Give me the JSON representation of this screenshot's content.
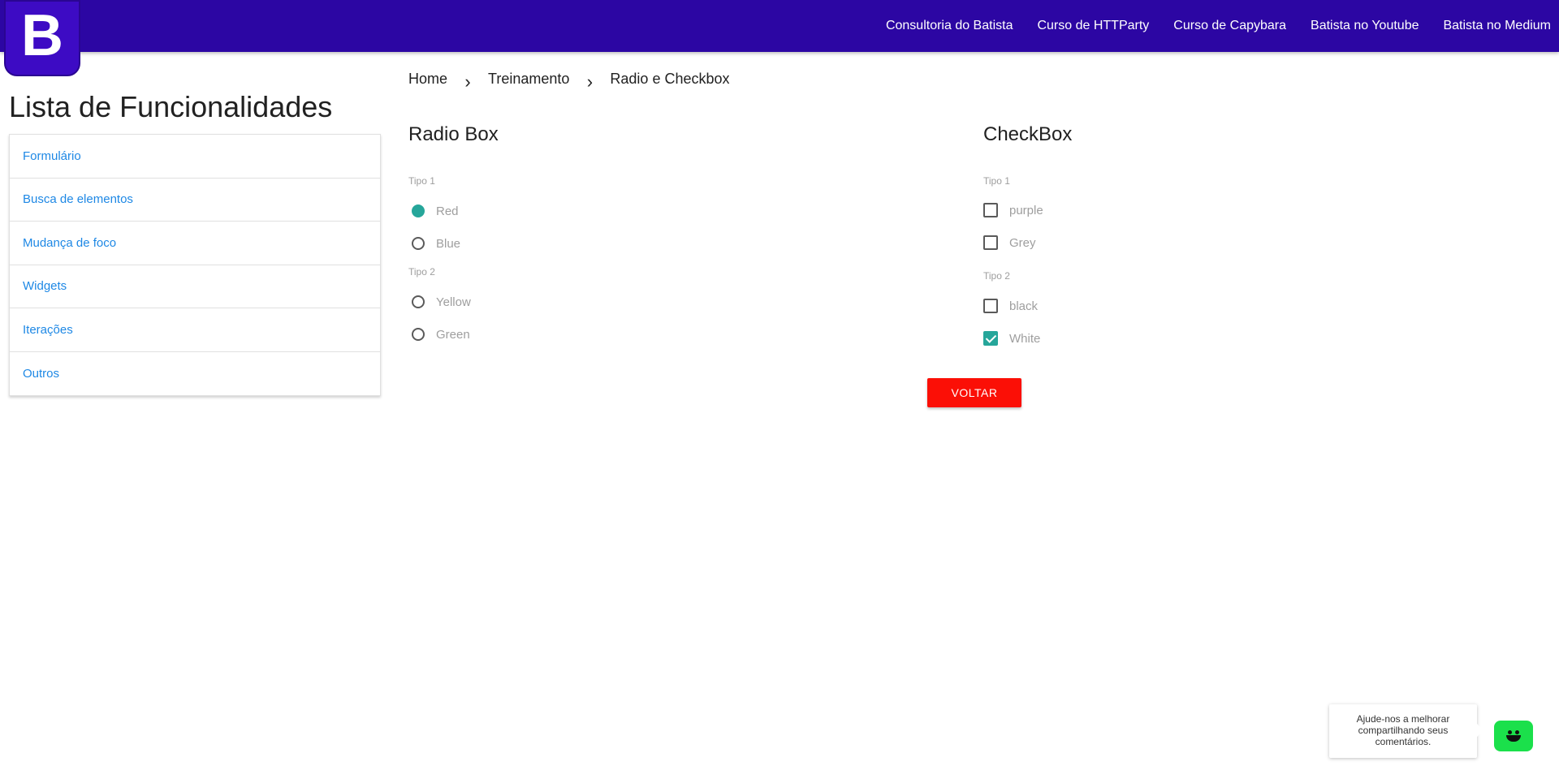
{
  "logo": {
    "letter": "B"
  },
  "nav": {
    "links": [
      "Consultoria do Batista",
      "Curso de HTTParty",
      "Curso de Capybara",
      "Batista no Youtube",
      "Batista no Medium"
    ]
  },
  "sidebar": {
    "title": "Lista de Funcionalidades",
    "items": [
      "Formulário",
      "Busca de elementos",
      "Mudança de foco",
      "Widgets",
      "Iterações",
      "Outros"
    ]
  },
  "breadcrumb": {
    "items": [
      "Home",
      "Treinamento",
      "Radio e Checkbox"
    ],
    "separator": "›"
  },
  "radio_section": {
    "title": "Radio Box",
    "groups": [
      {
        "label": "Tipo 1",
        "options": [
          {
            "label": "Red",
            "checked": true
          },
          {
            "label": "Blue",
            "checked": false
          }
        ]
      },
      {
        "label": "Tipo 2",
        "options": [
          {
            "label": "Yellow",
            "checked": false
          },
          {
            "label": "Green",
            "checked": false
          }
        ]
      }
    ]
  },
  "checkbox_section": {
    "title": "CheckBox",
    "groups": [
      {
        "label": "Tipo 1",
        "options": [
          {
            "label": "purple",
            "checked": false
          },
          {
            "label": "Grey",
            "checked": false
          }
        ]
      },
      {
        "label": "Tipo 2",
        "options": [
          {
            "label": "black",
            "checked": false
          },
          {
            "label": "White",
            "checked": true
          }
        ]
      }
    ]
  },
  "voltar_button": {
    "label": "VOLTAR"
  },
  "feedback": {
    "text": "Ajude-nos a melhorar compartilhando seus comentários."
  },
  "colors": {
    "nav_bg": "#2c06a3",
    "link": "#1e88e5",
    "accent": "#26a69a",
    "voltar": "#fb0f06",
    "feedback_btn": "#1be04b"
  }
}
